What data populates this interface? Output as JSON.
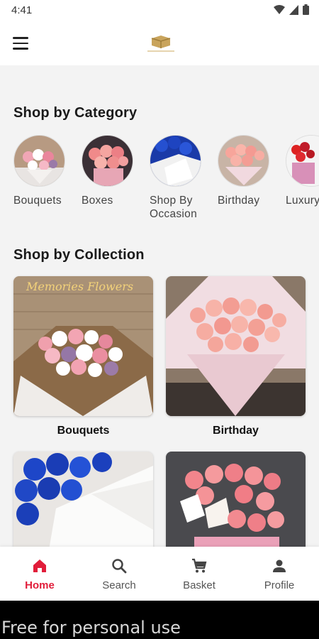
{
  "status_bar": {
    "time": "4:41",
    "icons": [
      "wifi-icon",
      "signal-icon",
      "battery-icon"
    ]
  },
  "app_bar": {
    "menu_icon": "hamburger-menu-icon",
    "logo": "brand-logo"
  },
  "categories": {
    "title": "Shop by Category",
    "items": [
      {
        "label": "Bouquets",
        "image": "bouquet-thumb"
      },
      {
        "label": "Boxes",
        "image": "box-thumb"
      },
      {
        "label": "Shop By Occasion",
        "image": "occasion-thumb"
      },
      {
        "label": "Birthday",
        "image": "birthday-thumb"
      },
      {
        "label": "Luxury Box",
        "image": "luxury-thumb"
      }
    ]
  },
  "collections": {
    "title": "Shop by Collection",
    "items": [
      {
        "label": "Bouquets",
        "image": "bouquets-collection-image",
        "overlay_text": "Memories Flowers"
      },
      {
        "label": "Birthday",
        "image": "birthday-collection-image"
      },
      {
        "label": "",
        "image": "blue-roses-collection-image"
      },
      {
        "label": "",
        "image": "pink-flowers-collection-image"
      }
    ]
  },
  "bottom_nav": {
    "items": [
      {
        "label": "Home",
        "icon": "home-icon",
        "active": true
      },
      {
        "label": "Search",
        "icon": "search-icon",
        "active": false
      },
      {
        "label": "Basket",
        "icon": "cart-icon",
        "active": false
      },
      {
        "label": "Profile",
        "icon": "person-icon",
        "active": false
      }
    ]
  },
  "watermark": {
    "text": "Free for personal use"
  },
  "colors": {
    "accent": "#e11d3a",
    "background": "#f3f3f3",
    "surface": "#ffffff"
  }
}
